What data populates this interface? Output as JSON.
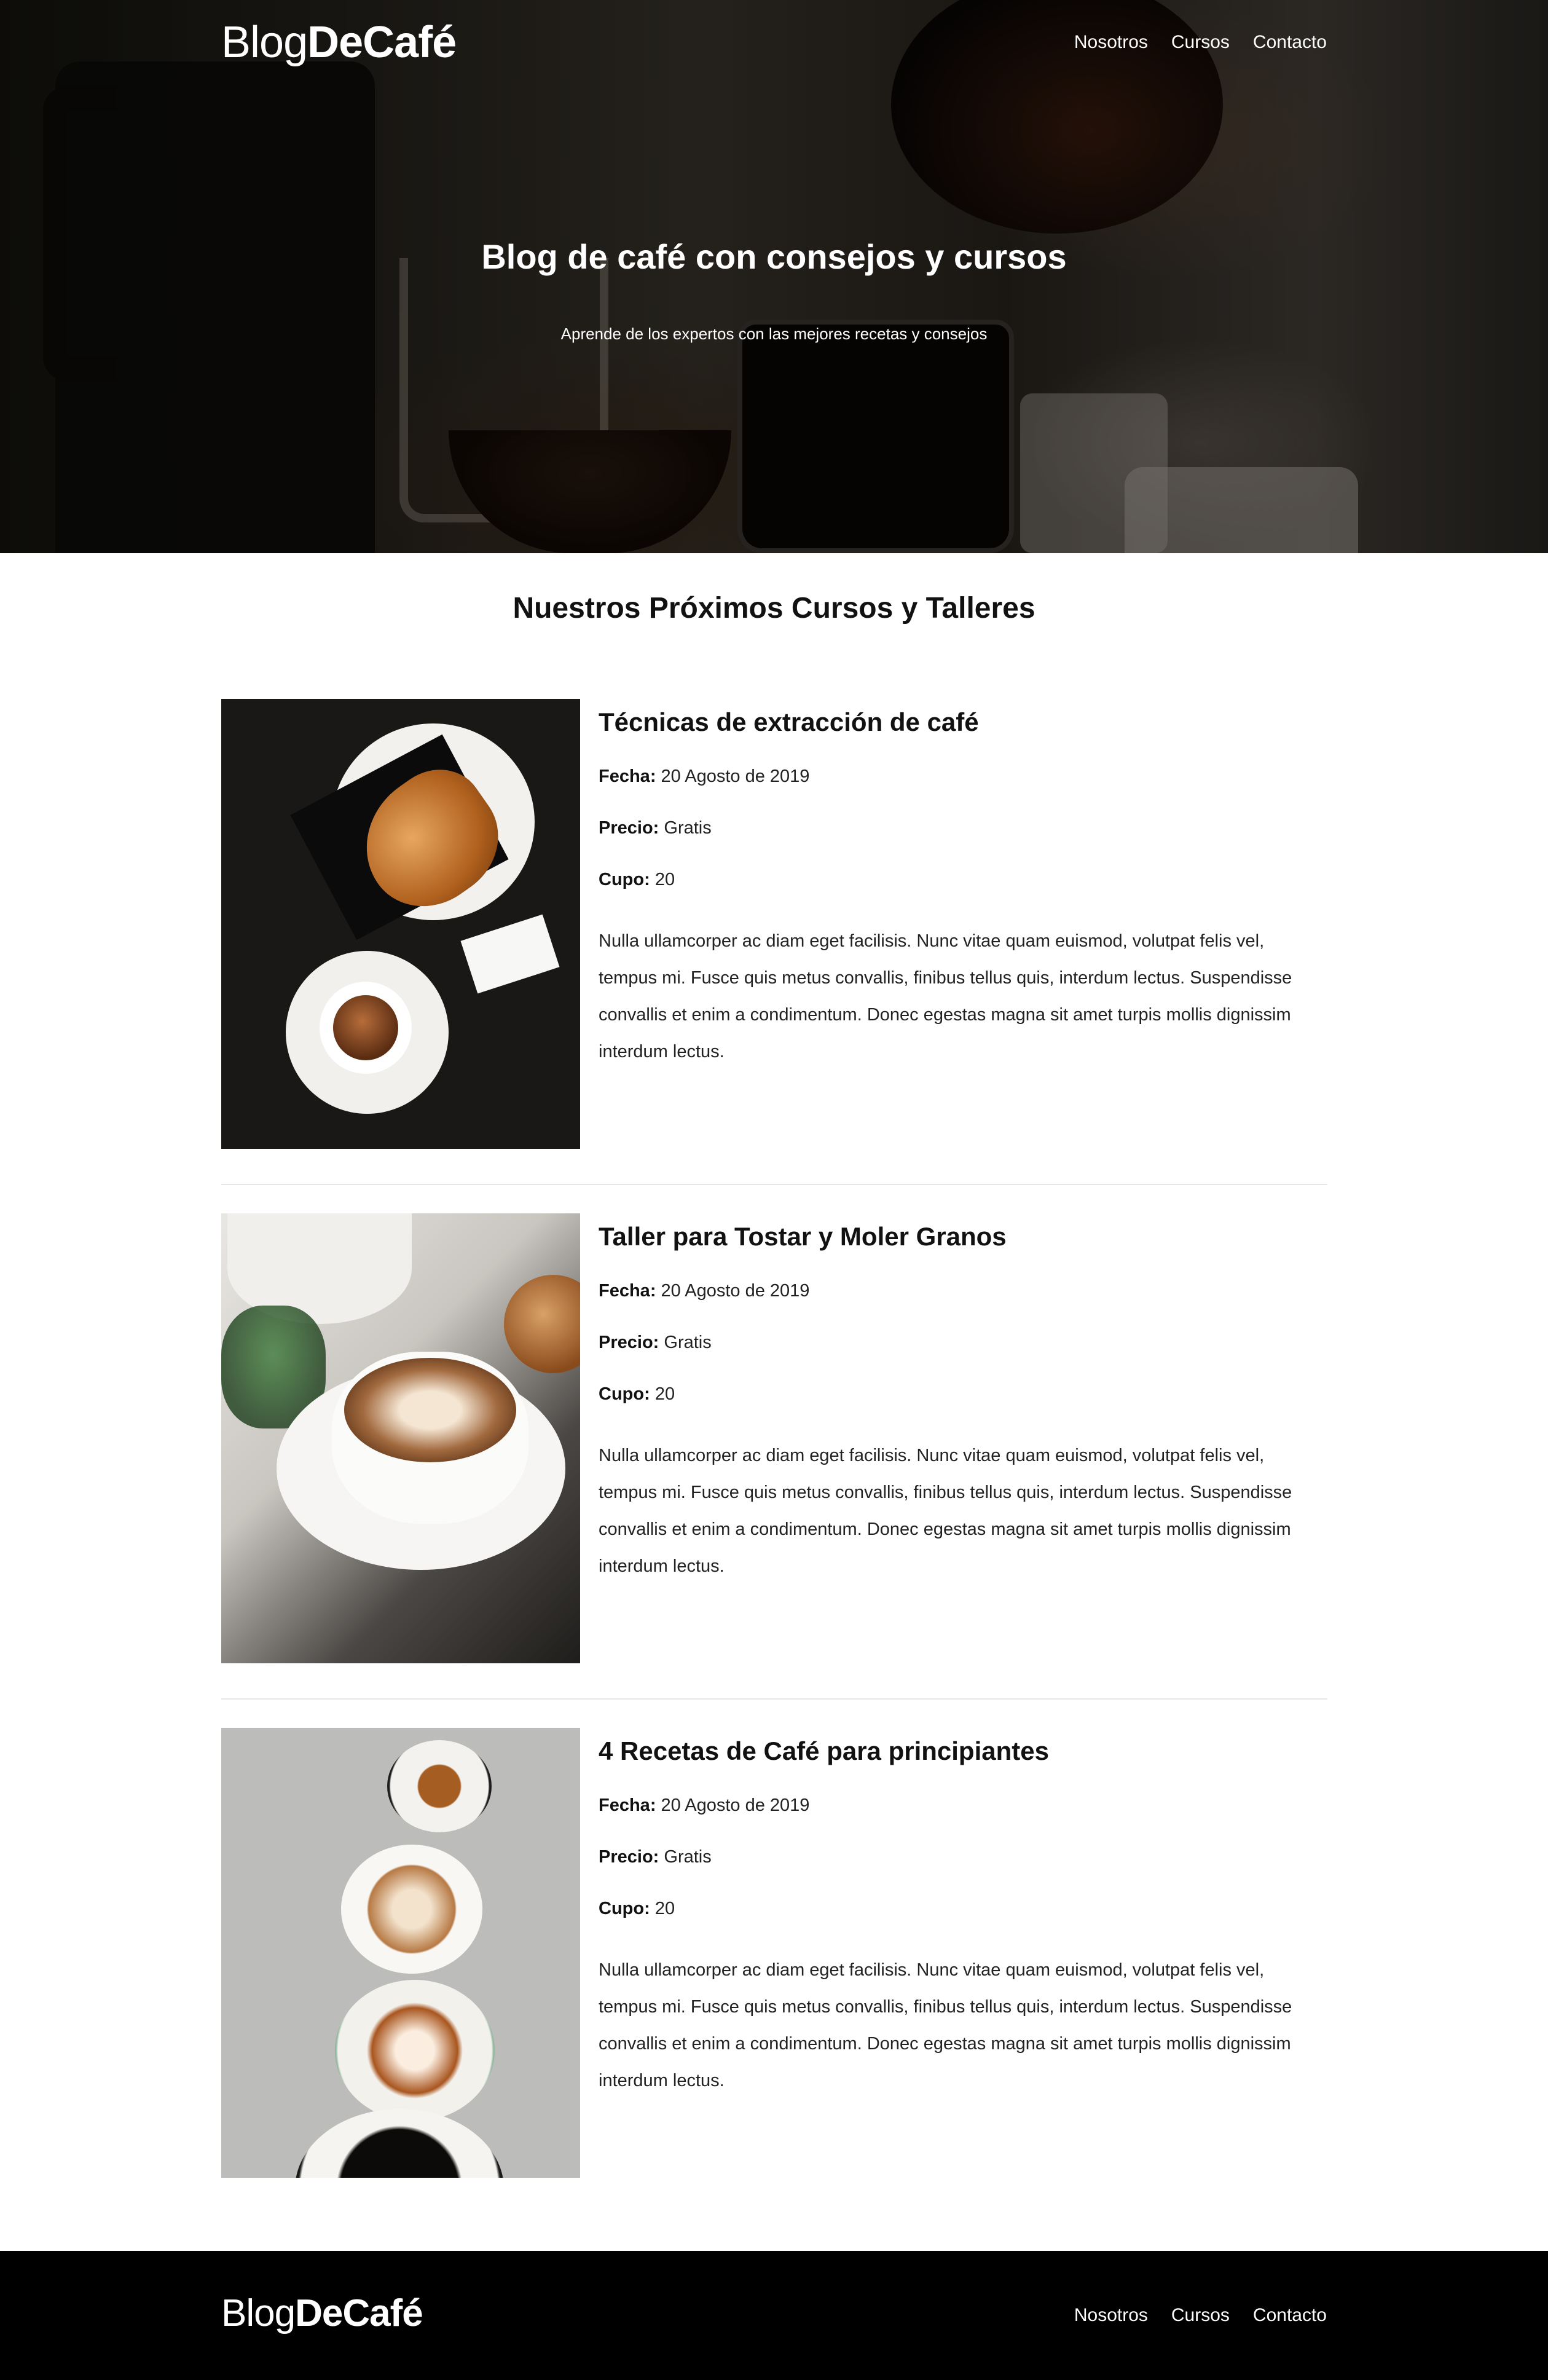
{
  "header": {
    "logo_light": "Blog",
    "logo_bold": "DeCafé",
    "nav": [
      "Nosotros",
      "Cursos",
      "Contacto"
    ]
  },
  "hero": {
    "title": "Blog de café con consejos y cursos",
    "subtitle": "Aprende de los expertos con las mejores recetas y consejos"
  },
  "main": {
    "section_title": "Nuestros Próximos Cursos y Talleres",
    "courses": [
      {
        "title": "Técnicas de extracción de café",
        "fecha_label": "Fecha:",
        "fecha": "20 Agosto de 2019",
        "precio_label": "Precio:",
        "precio": "Gratis",
        "cupo_label": "Cupo:",
        "cupo": "20",
        "description": "Nulla ullamcorper ac diam eget facilisis. Nunc vitae quam euismod, volutpat felis vel, tempus mi. Fusce quis metus convallis, finibus tellus quis, interdum lectus. Suspendisse convallis et enim a condimentum. Donec egestas magna sit amet turpis mollis dignissim interdum lectus."
      },
      {
        "title": "Taller para Tostar y Moler Granos",
        "fecha_label": "Fecha:",
        "fecha": "20 Agosto de 2019",
        "precio_label": "Precio:",
        "precio": "Gratis",
        "cupo_label": "Cupo:",
        "cupo": "20",
        "description": "Nulla ullamcorper ac diam eget facilisis. Nunc vitae quam euismod, volutpat felis vel, tempus mi. Fusce quis metus convallis, finibus tellus quis, interdum lectus. Suspendisse convallis et enim a condimentum. Donec egestas magna sit amet turpis mollis dignissim interdum lectus."
      },
      {
        "title": "4 Recetas de Café para principiantes",
        "fecha_label": "Fecha:",
        "fecha": "20 Agosto de 2019",
        "precio_label": "Precio:",
        "precio": "Gratis",
        "cupo_label": "Cupo:",
        "cupo": "20",
        "description": "Nulla ullamcorper ac diam eget facilisis. Nunc vitae quam euismod, volutpat felis vel, tempus mi. Fusce quis metus convallis, finibus tellus quis, interdum lectus. Suspendisse convallis et enim a condimentum. Donec egestas magna sit amet turpis mollis dignissim interdum lectus."
      }
    ]
  },
  "footer": {
    "logo_light": "Blog",
    "logo_bold": "DeCafé",
    "nav": [
      "Nosotros",
      "Cursos",
      "Contacto"
    ]
  },
  "colors": {
    "footer_bg": "#000000",
    "text": "#111111",
    "divider": "#e6e6e6"
  }
}
